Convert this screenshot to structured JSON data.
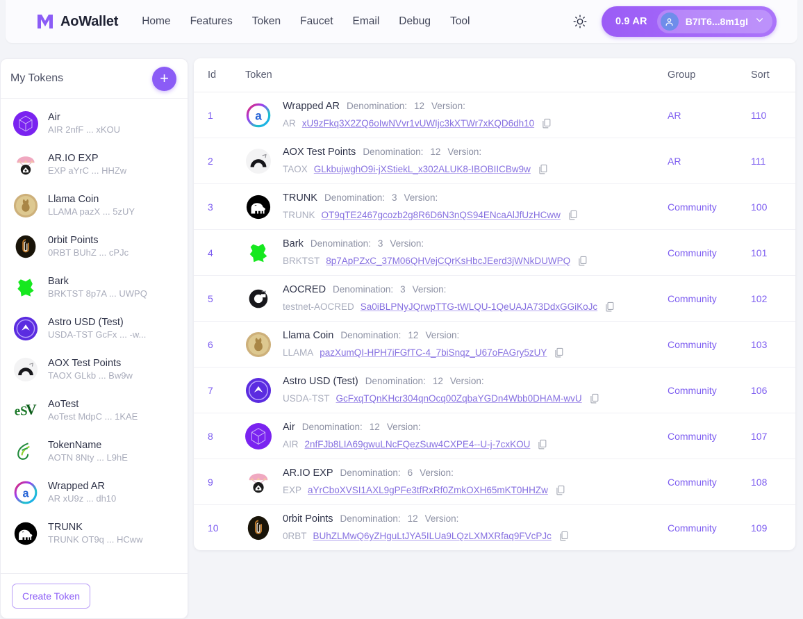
{
  "header": {
    "brand": "AoWallet",
    "brand_logo_icon": "m-logo-icon",
    "nav": [
      {
        "label": "Home"
      },
      {
        "label": "Features"
      },
      {
        "label": "Token"
      },
      {
        "label": "Faucet"
      },
      {
        "label": "Email"
      },
      {
        "label": "Debug"
      },
      {
        "label": "Tool"
      }
    ],
    "theme_toggle_icon": "sun-icon",
    "wallet": {
      "balance": "0.9 AR",
      "address": "B7IT6...8m1gI",
      "avatar_icon": "user-icon",
      "chevron_icon": "chevron-down-icon"
    },
    "accent_color": "#8b5cf6"
  },
  "sidebar": {
    "title": "My Tokens",
    "add_button_icon": "plus-icon",
    "create_button_label": "Create Token",
    "items": [
      {
        "name": "Air",
        "sub": "AIR 2nfF ... xKOU",
        "icon": "air-token-icon"
      },
      {
        "name": "AR.IO EXP",
        "sub": "EXP aYrC ... HHZw",
        "icon": "ario-exp-token-icon"
      },
      {
        "name": "Llama Coin",
        "sub": "LLAMA pazX ... 5zUY",
        "icon": "llama-coin-icon"
      },
      {
        "name": "0rbit Points",
        "sub": "0RBT BUhZ ... cPJc",
        "icon": "orbit-points-icon"
      },
      {
        "name": "Bark",
        "sub": "BRKTST 8p7A ... UWPQ",
        "icon": "bark-token-icon"
      },
      {
        "name": "Astro USD (Test)",
        "sub": "USDA-TST GcFx ... -w...",
        "icon": "astro-usd-icon"
      },
      {
        "name": "AOX Test Points",
        "sub": "TAOX GLkb ... Bw9w",
        "icon": "aox-test-points-icon"
      },
      {
        "name": "AoTest",
        "sub": "AoTest MdpC ... 1KAE",
        "icon": "aotest-icon"
      },
      {
        "name": "TokenName",
        "sub": "AOTN 8Nty ... L9hE",
        "icon": "tokenname-icon"
      },
      {
        "name": "Wrapped AR",
        "sub": "AR xU9z ... dh10",
        "icon": "wrapped-ar-icon"
      },
      {
        "name": "TRUNK",
        "sub": "TRUNK OT9q ... HCww",
        "icon": "trunk-icon"
      }
    ]
  },
  "table": {
    "columns": [
      {
        "key": "id",
        "label": "Id"
      },
      {
        "key": "token",
        "label": "Token"
      },
      {
        "key": "group",
        "label": "Group"
      },
      {
        "key": "sort",
        "label": "Sort"
      }
    ],
    "denomination_label": "Denomination:",
    "version_label": "Version:",
    "copy_icon": "copy-icon",
    "rows": [
      {
        "id": "1",
        "icon": "wrapped-ar-icon",
        "name": "Wrapped AR",
        "denomination": "12",
        "version": "",
        "ticker": "AR",
        "address": "xU9zFkq3X2ZQ6oIwNVvr1vUWIjc3kXTWr7xKQD6dh10",
        "group": "AR",
        "sort": "110"
      },
      {
        "id": "2",
        "icon": "aox-test-points-icon",
        "name": "AOX Test Points",
        "denomination": "12",
        "version": "",
        "ticker": "TAOX",
        "address": "GLkbujwghO9i-jXStiekL_x302ALUK8-IBOBIICBw9w",
        "group": "AR",
        "sort": "111"
      },
      {
        "id": "3",
        "icon": "trunk-icon",
        "name": "TRUNK",
        "denomination": "3",
        "version": "",
        "ticker": "TRUNK",
        "address": "OT9qTE2467gcozb2g8R6D6N3nQS94ENcaAlJfUzHCww",
        "group": "Community",
        "sort": "100"
      },
      {
        "id": "4",
        "icon": "bark-token-icon",
        "name": "Bark",
        "denomination": "3",
        "version": "",
        "ticker": "BRKTST",
        "address": "8p7ApPZxC_37M06QHVejCQrKsHbcJEerd3jWNkDUWPQ",
        "group": "Community",
        "sort": "101"
      },
      {
        "id": "5",
        "icon": "aocred-icon",
        "name": "AOCRED",
        "denomination": "3",
        "version": "",
        "ticker": "testnet-AOCRED",
        "address": "Sa0iBLPNyJQrwpTTG-tWLQU-1QeUAJA73DdxGGiKoJc",
        "group": "Community",
        "sort": "102"
      },
      {
        "id": "6",
        "icon": "llama-coin-icon",
        "name": "Llama Coin",
        "denomination": "12",
        "version": "",
        "ticker": "LLAMA",
        "address": "pazXumQI-HPH7iFGfTC-4_7biSnqz_U67oFAGry5zUY",
        "group": "Community",
        "sort": "103"
      },
      {
        "id": "7",
        "icon": "astro-usd-icon",
        "name": "Astro USD (Test)",
        "denomination": "12",
        "version": "",
        "ticker": "USDA-TST",
        "address": "GcFxqTQnKHcr304qnOcq00ZqbaYGDn4Wbb0DHAM-wvU",
        "group": "Community",
        "sort": "106"
      },
      {
        "id": "8",
        "icon": "air-token-icon",
        "name": "Air",
        "denomination": "12",
        "version": "",
        "ticker": "AIR",
        "address": "2nfFJb8LIA69gwuLNcFQezSuw4CXPE4--U-j-7cxKOU",
        "group": "Community",
        "sort": "107"
      },
      {
        "id": "9",
        "icon": "ario-exp-token-icon",
        "name": "AR.IO EXP",
        "denomination": "6",
        "version": "",
        "ticker": "EXP",
        "address": "aYrCboXVSI1AXL9gPFe3tfRxRf0ZmkOXH65mKT0HHZw",
        "group": "Community",
        "sort": "108"
      },
      {
        "id": "10",
        "icon": "orbit-points-icon",
        "name": "0rbit Points",
        "denomination": "12",
        "version": "",
        "ticker": "0RBT",
        "address": "BUhZLMwQ6yZHguLtJYA5ILUa9LQzLXMXRfaq9FVcPJc",
        "group": "Community",
        "sort": "109"
      }
    ]
  }
}
